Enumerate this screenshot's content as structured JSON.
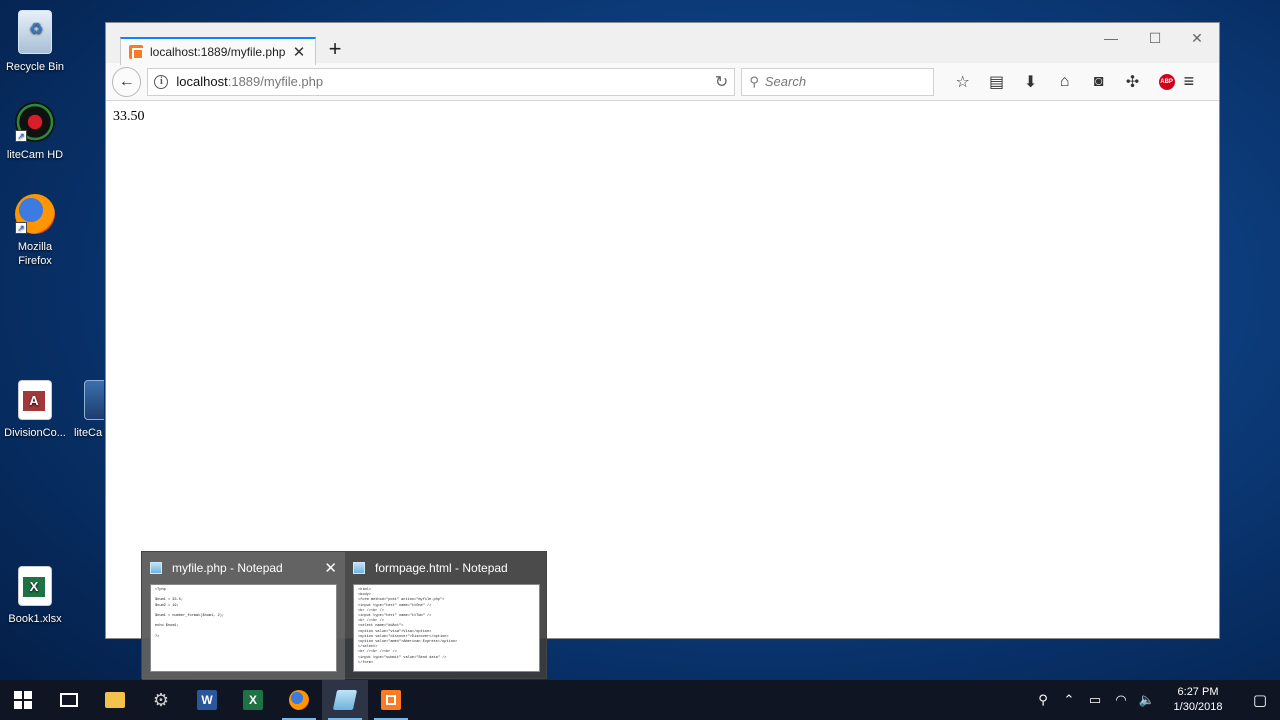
{
  "desktop": {
    "icons": [
      {
        "label": "Recycle Bin"
      },
      {
        "label": "liteCam HD"
      },
      {
        "label": "Mozilla Firefox"
      },
      {
        "label": "DivisionCo..."
      },
      {
        "label": "liteCa"
      },
      {
        "label": "Book1.xlsx"
      }
    ]
  },
  "browser": {
    "tab_title": "localhost:1889/myfile.php",
    "url_host": "localhost",
    "url_path": ":1889/myfile.php",
    "search_placeholder": "Search",
    "page_output": "33.50"
  },
  "thumbnails": [
    {
      "title": "myfile.php - Notepad",
      "code": "<?php\n\n$num1 = 33.5;\n$num2 = 19;\n\n$num1 = number_format($num1, 2);\n\necho $num1;\n\n?>"
    },
    {
      "title": "formpage.html - Notepad",
      "code": "<html>\n<body>\n<form method=\"post\" action=\"myfile.php\">\n<input type=\"text\" name=\"ttOne\" />\n<br /><br />\n<input type=\"text\" name=\"ttTwo\" />\n<br /><br />\n<select name=\"ddAct\">\n<option value=\"visa\">Visa</option>\n<option value=\"discover\">Discover</option>\n<option value=\"amex\">American Express</option>\n</select>\n<br /><br /><br />\n<input type=\"submit\" value=\"Send data\" />\n</form>"
    }
  ],
  "taskbar": {
    "clock_time": "6:27 PM",
    "clock_date": "1/30/2018"
  },
  "icons": {
    "start": "windows-logo-icon",
    "task_view": "task-view-icon",
    "explorer": "folder-icon",
    "word": "word-icon",
    "excel": "excel-icon",
    "firefox": "firefox-icon",
    "notepad": "notepad-icon",
    "xampp": "xampp-icon"
  },
  "colors": {
    "accent": "#0a84ff",
    "xampp": "#fb7a24",
    "abp": "#d0021b",
    "taskbar": "#101523"
  }
}
